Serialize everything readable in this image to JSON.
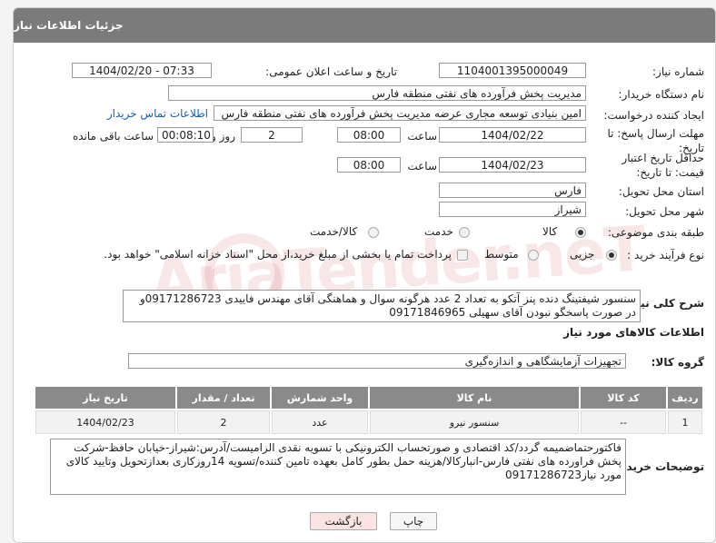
{
  "header": {
    "title": "جزئیات اطلاعات نیاز"
  },
  "labels": {
    "need_number": "شماره نیاز:",
    "announce_datetime": "تاریخ و ساعت اعلان عمومی:",
    "buyer_org": "نام دستگاه خریدار:",
    "requester": "ایجاد کننده درخواست:",
    "reply_deadline": "مهلت ارسال پاسخ: تا تاریخ:",
    "min_price_validity": "حداقل تاریخ اعتبار قیمت: تا تاریخ:",
    "hour": "ساعت",
    "day_and": "روز و",
    "remaining": "ساعت باقی مانده",
    "delivery_province": "استان محل تحویل:",
    "delivery_city": "شهر محل تحویل:",
    "category": "طبقه بندی موضوعی:",
    "process_type": "نوع فرآیند خرید :",
    "general_description": "شرح کلی نیاز:",
    "goods_info": "اطلاعات کالاهای مورد نیاز",
    "goods_group": "گروه کالا:",
    "buyer_notes": "توضیحات خریدار:"
  },
  "fields": {
    "need_number": "1104001395000049",
    "announce_datetime": "1404/02/20 - 07:33",
    "buyer_org": "مدیریت پخش فرآورده های نفتی منطقه فارس",
    "requester": "امین بنیادی توسعه مجاری عرضه مدیریت پخش فرآورده های نفتی منطقه فارس",
    "contact_link": "اطلاعات تماس خریدار",
    "reply_date": "1404/02/22",
    "reply_time": "08:00",
    "remaining_days": "2",
    "remaining_time": "00:08:10",
    "validity_date": "1404/02/23",
    "validity_time": "08:00",
    "delivery_province": "فارس",
    "delivery_city": "شیراز",
    "general_description": "سنسور شیفتینگ دنده پنز آتکو به تعداد 2 عدد هرگونه سوال و هماهنگی آقای مهندس فاییدی 09171286723و در صورت پاسخگو نبودن آقای سهیلی 09171846965",
    "goods_group": "تجهیزات آزمایشگاهی و اندازه‌گیری",
    "buyer_notes": "فاکتورحتماضمیمه گردد/کد اقتصادی و صورتحساب الکترونیکی با تسویه نقدی الزامیست/آدرس:شیراز-خیابان حافظ-شرکت پخش فراورده های نفتی فارس-انبارکالا/هزینه حمل بطور کامل بعهده تامین کننده/تسویه 14روزکاری بعدازتحویل وتایید کالای مورد نیاز09171286723"
  },
  "category_options": [
    "کالا",
    "خدمت",
    "کالا/خدمت"
  ],
  "category_selected": "کالا",
  "process_options": [
    "جزیی",
    "متوسط"
  ],
  "process_selected": "جزیی",
  "process_note": "پرداخت تمام یا بخشی از مبلغ خرید،از محل \"اسناد خزانه اسلامی\" خواهد بود.",
  "table": {
    "headers": [
      "ردیف",
      "کد کالا",
      "نام کالا",
      "واحد شمارش",
      "تعداد / مقدار",
      "تاریخ نیاز"
    ],
    "rows": [
      [
        "1",
        "--",
        "سنسور نیرو",
        "عدد",
        "2",
        "1404/02/23"
      ]
    ]
  },
  "buttons": {
    "print": "چاپ",
    "back": "بازگشت"
  },
  "watermark": "AriaTender.neT",
  "colors": {
    "header_bg": "#7b7b7b",
    "link": "#1a5fb4",
    "back_btn_bg": "#fbe3e3"
  }
}
